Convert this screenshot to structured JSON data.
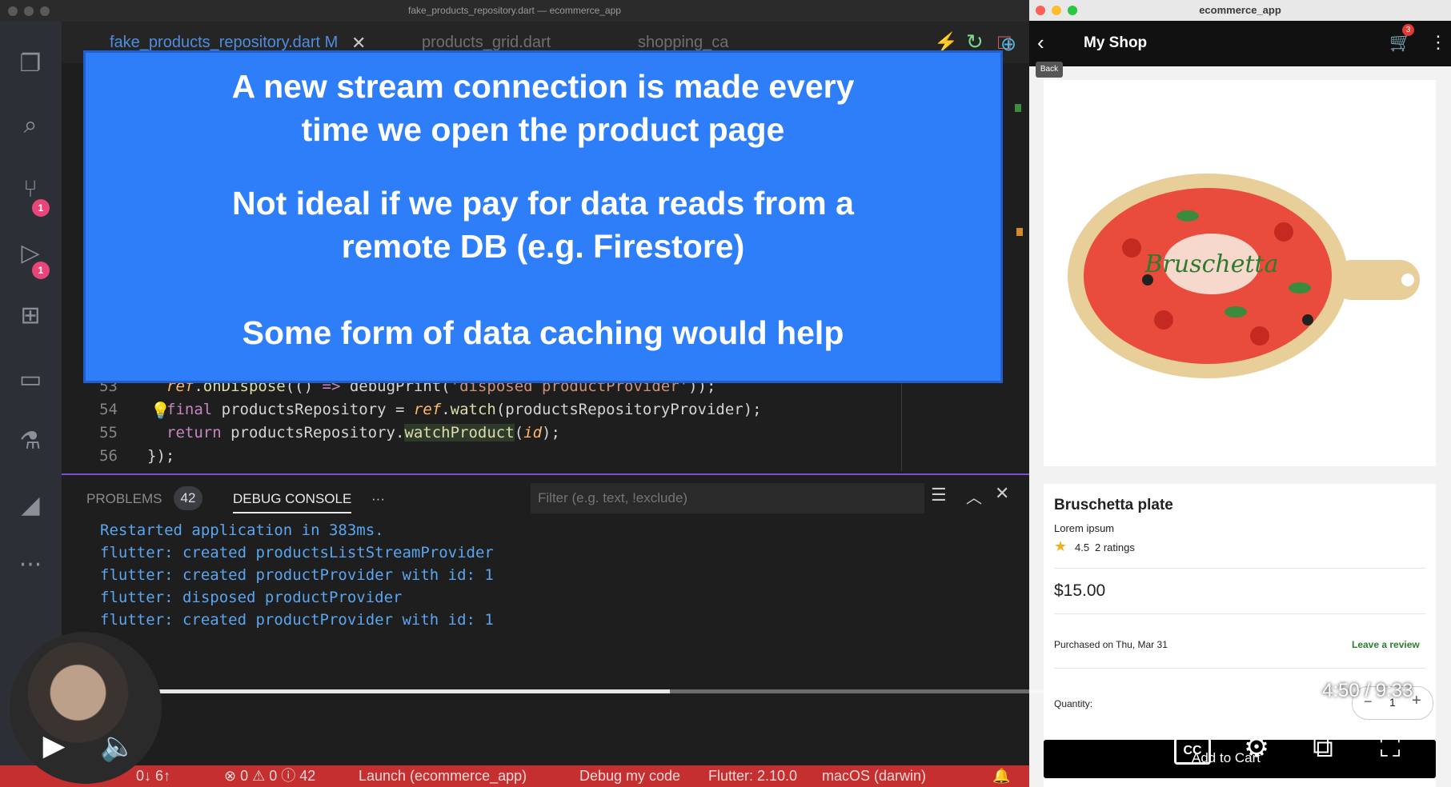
{
  "vscode": {
    "title": "fake_products_repository.dart — ecommerce_app",
    "tabs": [
      "fake_products_repository.dart M",
      "products_grid.dart",
      "shopping_ca"
    ],
    "overlay": {
      "line1": "A new stream connection is made every",
      "line2": "time we open the product page",
      "line3": "Not ideal if we pay for data reads from a",
      "line4": "remote DB (e.g. Firestore)",
      "line5": "Some form of data caching would help"
    },
    "code_lines": [
      {
        "num": "53"
      },
      {
        "num": "54"
      },
      {
        "num": "55"
      },
      {
        "num": "56"
      }
    ],
    "code": {
      "l53a": "ref",
      "l53b": ".",
      "l53c": "onDispose",
      "l53d": "(() ",
      "l53e": "=>",
      "l53f": " debugPrint(",
      "l53g": "'disposed productProvider'",
      "l53h": "));",
      "l54a": "final",
      "l54b": " productsRepository = ",
      "l54c": "ref",
      "l54d": ".",
      "l54e": "watch",
      "l54f": "(productsRepositoryProvider);",
      "l55a": "return",
      "l55b": " productsRepository.",
      "l55c": "watchProduct",
      "l55d": "(",
      "l55e": "id",
      "l55f": ");",
      "l56": "});"
    },
    "panel": {
      "problems_label": "PROBLEMS",
      "problems_count": "42",
      "debug_label": "DEBUG CONSOLE",
      "more": "···",
      "filter_placeholder": "Filter (e.g. text, !exclude)",
      "console_lines": [
        "Restarted application in 383ms.",
        "flutter: created productsListStreamProvider",
        "flutter: created productProvider with id: 1",
        "flutter: disposed productProvider",
        "flutter: created productProvider with id: 1"
      ]
    },
    "status": {
      "sync": "0↓ 6↑",
      "errors": "⊗ 0 ⚠ 0 ⓘ 42",
      "launch": "Launch (ecommerce_app)",
      "debug": "Debug my code",
      "flutter": "Flutter: 2.10.0",
      "os": "macOS (darwin)"
    },
    "badges": {
      "scm": "1",
      "debug": "1"
    }
  },
  "app": {
    "window_title": "ecommerce_app",
    "appbar_title": "My Shop",
    "cart_count": "3",
    "tooltip": "Back",
    "product_image_text": "Bruschetta",
    "product_name": "Bruschetta plate",
    "description": "Lorem ipsum",
    "rating": "4.5",
    "ratings_count": "2 ratings",
    "price": "$15.00",
    "purchased": "Purchased on Thu, Mar 31",
    "leave_review": "Leave a review",
    "quantity_label": "Quantity:",
    "quantity_value": "1",
    "add_to_cart": "Add to Cart"
  },
  "video": {
    "time": "4:50 / 9:33",
    "progress": 0.505
  },
  "colors": {
    "overlay": "#2e7df9",
    "statusbar": "#c62f2f",
    "console_text": "#5aa5f0"
  }
}
